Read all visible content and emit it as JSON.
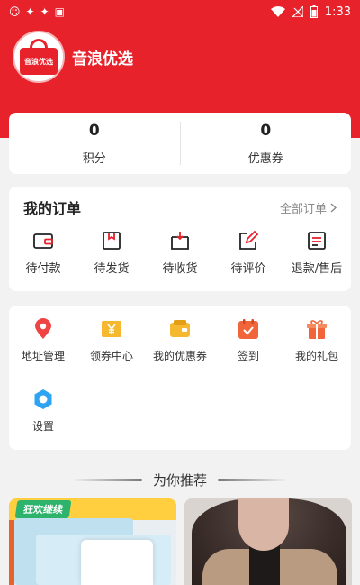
{
  "status_bar": {
    "time": "1:33"
  },
  "profile": {
    "logo_text": "音浪优选",
    "shop_name": "音浪优选"
  },
  "points": [
    {
      "value": "0",
      "label": "积分"
    },
    {
      "value": "0",
      "label": "优惠券"
    }
  ],
  "orders": {
    "title": "我的订单",
    "all_label": "全部订单",
    "items": [
      {
        "label": "待付款",
        "icon": "wallet-icon"
      },
      {
        "label": "待发货",
        "icon": "box-icon"
      },
      {
        "label": "待收货",
        "icon": "receive-box-icon"
      },
      {
        "label": "待评价",
        "icon": "edit-icon"
      },
      {
        "label": "退款/售后",
        "icon": "refund-list-icon"
      }
    ]
  },
  "tools": {
    "items": [
      {
        "label": "地址管理",
        "icon": "location-pin-icon",
        "color": "#ef4444"
      },
      {
        "label": "领券中心",
        "icon": "coupon-yen-icon",
        "color": "#f5b82e"
      },
      {
        "label": "我的优惠券",
        "icon": "wallet-coupon-icon",
        "color": "#f5b82e"
      },
      {
        "label": "签到",
        "icon": "calendar-check-icon",
        "color": "#f0663a"
      },
      {
        "label": "我的礼包",
        "icon": "gift-icon",
        "color": "#f0663a"
      },
      {
        "label": "设置",
        "icon": "gear-icon",
        "color": "#2ea3f2"
      }
    ]
  },
  "recommend": {
    "title": "为你推荐",
    "products": [
      {
        "tag": "狂欢继续"
      },
      {}
    ]
  },
  "colors": {
    "brand_red": "#e8222b",
    "background": "#f2f2f2"
  }
}
